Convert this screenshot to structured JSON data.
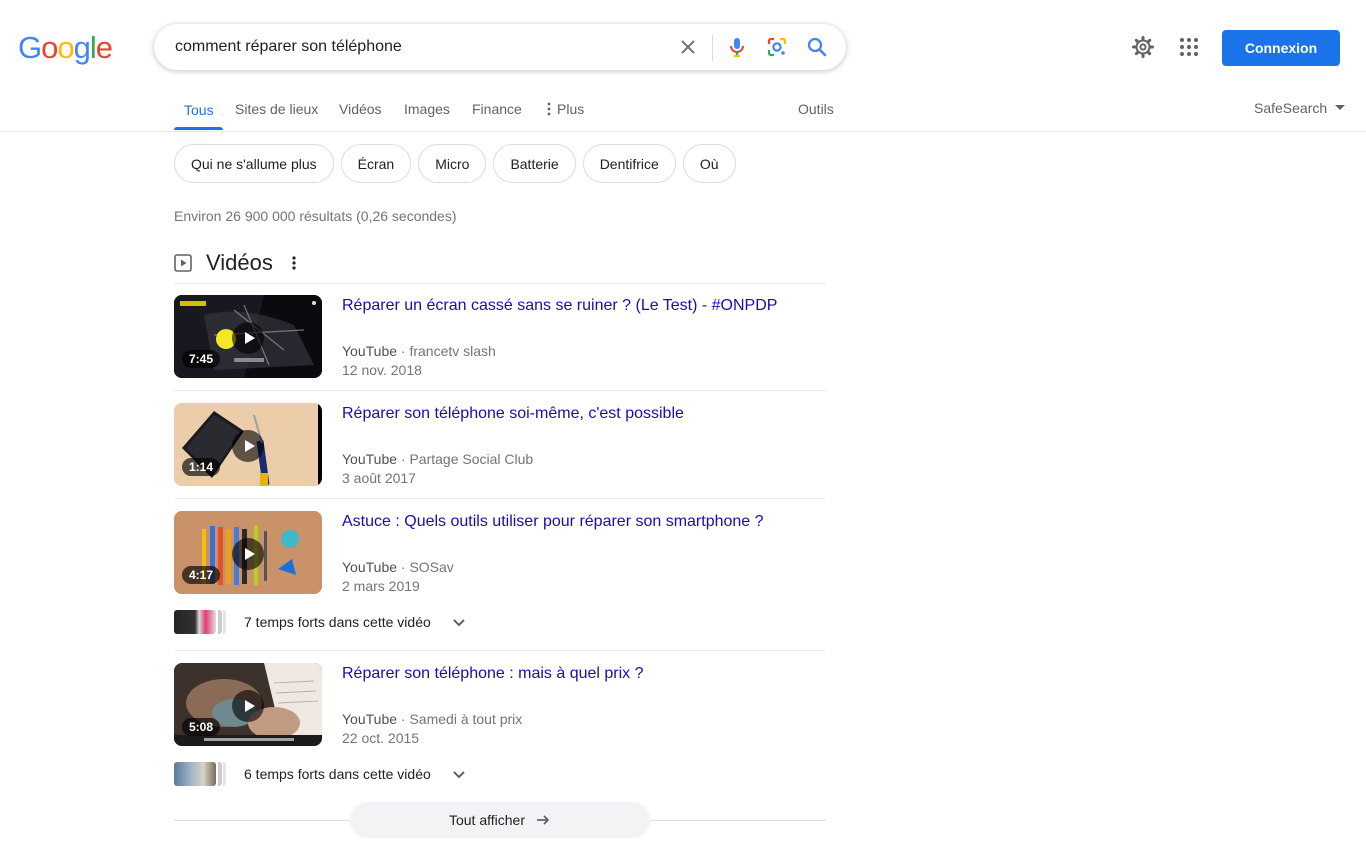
{
  "logo": {
    "letters": [
      "G",
      "o",
      "o",
      "g",
      "l",
      "e"
    ]
  },
  "search": {
    "query": "comment réparer son téléphone"
  },
  "header": {
    "signin_label": "Connexion"
  },
  "tabs": [
    {
      "label": "Tous"
    },
    {
      "label": "Sites de lieux"
    },
    {
      "label": "Vidéos"
    },
    {
      "label": "Images"
    },
    {
      "label": "Finance"
    },
    {
      "label": "Plus"
    }
  ],
  "tools_label": "Outils",
  "safesearch_label": "SafeSearch",
  "chips": [
    {
      "label": "Qui ne s'allume plus"
    },
    {
      "label": "Écran"
    },
    {
      "label": "Micro"
    },
    {
      "label": "Batterie"
    },
    {
      "label": "Dentifrice"
    },
    {
      "label": "Où"
    }
  ],
  "result_stats": "Environ 26 900 000 résultats (0,26 secondes)",
  "videos": {
    "section_title": "Vidéos",
    "items": [
      {
        "title": "Réparer un écran cassé sans se ruiner ? (Le Test) - #ONPDP",
        "source": "YouTube",
        "channel": "· francetv slash",
        "date": "12 nov. 2018",
        "duration": "7:45"
      },
      {
        "title": "Réparer son téléphone soi-même, c'est possible",
        "source": "YouTube",
        "channel": "· Partage Social Club",
        "date": "3 août 2017",
        "duration": "1:14"
      },
      {
        "title": "Astuce : Quels outils utiliser pour réparer son smartphone ?",
        "source": "YouTube",
        "channel": "· SOSav",
        "date": "2 mars 2019",
        "duration": "4:17"
      },
      {
        "title": "Réparer son téléphone : mais à quel prix ?",
        "source": "YouTube",
        "channel": "· Samedi à tout prix",
        "date": "22 oct. 2015",
        "duration": "5:08"
      }
    ],
    "key_moments": [
      {
        "label": "7 temps forts dans cette vidéo"
      },
      {
        "label": "6 temps forts dans cette vidéo"
      }
    ],
    "show_all_label": "Tout afficher"
  },
  "colors": {
    "link": "#1a0dab",
    "accent": "#1a73e8",
    "google_blue": "#4285f4",
    "google_red": "#ea4335",
    "google_yellow": "#fbbc05",
    "google_green": "#34a853"
  }
}
